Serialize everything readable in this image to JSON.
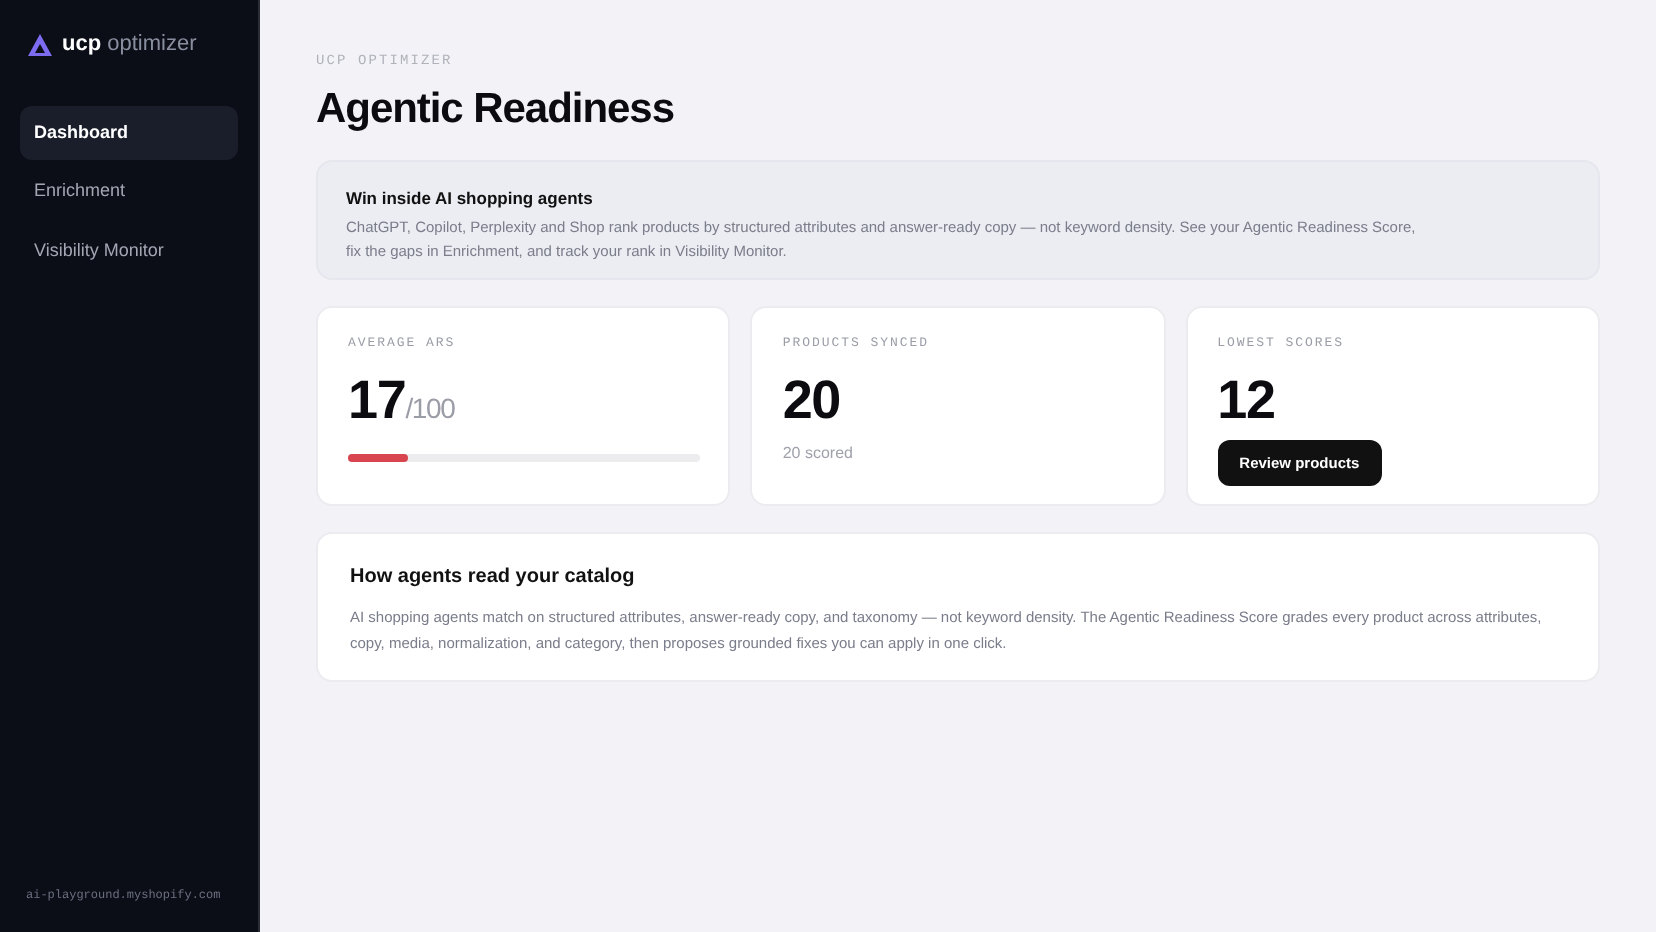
{
  "brand": {
    "strong": "ucp",
    "light": "optimizer"
  },
  "sidebar": {
    "items": [
      {
        "label": "Dashboard",
        "selected": true
      },
      {
        "label": "Enrichment",
        "selected": false
      },
      {
        "label": "Visibility Monitor",
        "selected": false
      }
    ],
    "footer": "ai-playground.myshopify.com"
  },
  "page": {
    "eyebrow": "UCP OPTIMIZER",
    "title": "Agentic Readiness"
  },
  "banner": {
    "title": "Win inside AI shopping agents",
    "text": "ChatGPT, Copilot, Perplexity and Shop rank products by structured attributes and answer-ready copy — not keyword density. See your Agentic Readiness Score, fix the gaps in Enrichment, and track your rank in Visibility Monitor."
  },
  "stats": [
    {
      "kind": "meter",
      "label": "AVERAGE ARS",
      "value": "17",
      "suffix": "/100",
      "level": 0.17
    },
    {
      "kind": "note",
      "label": "PRODUCTS SYNCED",
      "value": "20",
      "note": "20 scored"
    },
    {
      "kind": "action",
      "label": "LOWEST SCORES",
      "value": "12",
      "button": "Review products"
    }
  ],
  "info": {
    "title": "How agents read your catalog",
    "text": "AI shopping agents match on structured attributes, answer-ready copy, and taxonomy — not keyword density. The Agentic Readiness Score grades every product across attributes, copy, media, normalization, and category, then proposes grounded fixes you can apply in one click."
  }
}
